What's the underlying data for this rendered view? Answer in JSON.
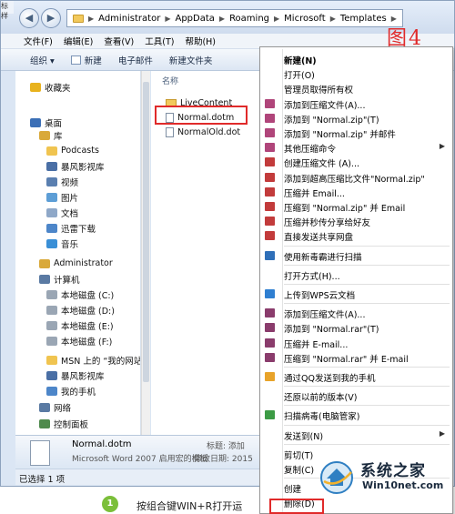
{
  "corner_fragment": "标样",
  "address": {
    "segments": [
      "Administrator",
      "AppData",
      "Roaming",
      "Microsoft",
      "Templates"
    ]
  },
  "menubar": [
    "文件(F)",
    "编辑(E)",
    "查看(V)",
    "工具(T)",
    "帮助(H)"
  ],
  "toolbar": {
    "organize": "组织 ▾",
    "new": "新建",
    "email": "电子邮件",
    "new_folder": "新建文件夹"
  },
  "nav": [
    {
      "label": "收藏夹",
      "icon": "star-icon",
      "color": "#e8b21d"
    },
    {
      "label": "桌面",
      "icon": "desktop-icon",
      "color": "#3b6fb6"
    },
    {
      "label": "库",
      "icon": "library-icon",
      "color": "#d9a93a"
    },
    {
      "label": "Podcasts",
      "icon": "folder-icon",
      "color": "#f0c450"
    },
    {
      "label": "暴风影视库",
      "icon": "media-library-icon",
      "color": "#4a6fa5"
    },
    {
      "label": "视频",
      "icon": "video-icon",
      "color": "#5a7fb0"
    },
    {
      "label": "图片",
      "icon": "picture-icon",
      "color": "#5d9ed6"
    },
    {
      "label": "文档",
      "icon": "document-icon",
      "color": "#8fa8c8"
    },
    {
      "label": "迅雷下载",
      "icon": "download-icon",
      "color": "#4d86c9"
    },
    {
      "label": "音乐",
      "icon": "music-icon",
      "color": "#3a8fd6"
    },
    {
      "label": "Administrator",
      "icon": "user-folder-icon",
      "color": "#d9a93a"
    },
    {
      "label": "计算机",
      "icon": "computer-icon",
      "color": "#5a7aa3"
    },
    {
      "label": "本地磁盘 (C:)",
      "icon": "drive-icon",
      "color": "#9aa6b4"
    },
    {
      "label": "本地磁盘 (D:)",
      "icon": "drive-icon",
      "color": "#9aa6b4"
    },
    {
      "label": "本地磁盘 (E:)",
      "icon": "drive-icon",
      "color": "#9aa6b4"
    },
    {
      "label": "本地磁盘 (F:)",
      "icon": "drive-icon",
      "color": "#9aa6b4"
    },
    {
      "label": "MSN 上的 “我的网站",
      "icon": "folder-icon",
      "color": "#f0c450"
    },
    {
      "label": "暴风影视库",
      "icon": "media-library-icon",
      "color": "#4a6fa5"
    },
    {
      "label": "我的手机",
      "icon": "phone-icon",
      "color": "#4d86c9"
    },
    {
      "label": "网络",
      "icon": "network-icon",
      "color": "#5a7aa3"
    },
    {
      "label": "控制面板",
      "icon": "control-panel-icon",
      "color": "#4f8a4c"
    }
  ],
  "files": {
    "column_header": "名称",
    "items": [
      {
        "name": "LiveContent",
        "kind": "folder"
      },
      {
        "name": "Normal.dotm",
        "kind": "doc"
      },
      {
        "name": "NormalOld.dot",
        "kind": "doc"
      }
    ]
  },
  "details": {
    "name": "Normal.dotm",
    "type": "Microsoft Word 2007 启用宏的模板",
    "tag_label": "标题: 添加",
    "modified": "修改日期: 2015"
  },
  "status": "已选择 1 项",
  "context_menu": [
    {
      "label": "新建(N)",
      "icon": "",
      "bold": true
    },
    {
      "label": "打开(O)",
      "icon": ""
    },
    {
      "label": "管理员取得所有权",
      "icon": ""
    },
    {
      "label": "添加到压缩文件(A)...",
      "icon": "winrar-icon"
    },
    {
      "label": "添加到 \"Normal.zip\"(T)",
      "icon": "winrar-icon"
    },
    {
      "label": "添加到 \"Normal.zip\" 并邮件",
      "icon": "winrar-icon"
    },
    {
      "label": "其他压缩命令",
      "icon": "winrar-icon",
      "sub": true
    },
    {
      "label": "创建压缩文件 (A)...",
      "icon": "haozip-icon"
    },
    {
      "label": "添加到超高压缩比文件\"Normal.zip\"",
      "icon": "haozip-icon"
    },
    {
      "label": "压缩并 Email...",
      "icon": "haozip-icon"
    },
    {
      "label": "压缩到 \"Normal.zip\" 并 Email",
      "icon": "haozip-icon"
    },
    {
      "label": "压缩并秒传分享给好友",
      "icon": "haozip-icon"
    },
    {
      "label": "直接发送共享网盘",
      "icon": "haozip-icon"
    },
    {
      "sep": true
    },
    {
      "label": "使用新毒霸进行扫描",
      "icon": "duba-icon"
    },
    {
      "sep": true
    },
    {
      "label": "打开方式(H)...",
      "icon": ""
    },
    {
      "sep": true
    },
    {
      "label": "上传到WPS云文档",
      "icon": "wps-cloud-icon"
    },
    {
      "sep": true
    },
    {
      "label": "添加到压缩文件(A)...",
      "icon": "rar-books-icon"
    },
    {
      "label": "添加到 \"Normal.rar\"(T)",
      "icon": "rar-books-icon"
    },
    {
      "label": "压缩并 E-mail...",
      "icon": "rar-books-icon"
    },
    {
      "label": "压缩到 \"Normal.rar\" 并 E-mail",
      "icon": "rar-books-icon"
    },
    {
      "sep": true
    },
    {
      "label": "通过QQ发送到我的手机",
      "icon": "qq-icon"
    },
    {
      "sep": true
    },
    {
      "label": "还原以前的版本(V)",
      "icon": ""
    },
    {
      "sep": true
    },
    {
      "label": "扫描病毒(电脑管家)",
      "icon": "shield-icon"
    },
    {
      "sep": true
    },
    {
      "label": "发送到(N)",
      "icon": "",
      "sub": true
    },
    {
      "sep": true
    },
    {
      "label": "剪切(T)",
      "icon": ""
    },
    {
      "label": "复制(C)",
      "icon": ""
    },
    {
      "sep": true
    },
    {
      "label": "创建",
      "icon": ""
    },
    {
      "label": "删除(D)",
      "icon": ""
    }
  ],
  "annotation": "图4",
  "watermark": {
    "title": "系统之家",
    "subtitle": "Win10net.com"
  },
  "instruction": {
    "step": "1",
    "text": "按组合键WIN+R打开运"
  },
  "colors": {
    "highlight": "#e02a2a",
    "step_badge": "#7bbf3a",
    "window_chrome": "#dbe6f4"
  }
}
